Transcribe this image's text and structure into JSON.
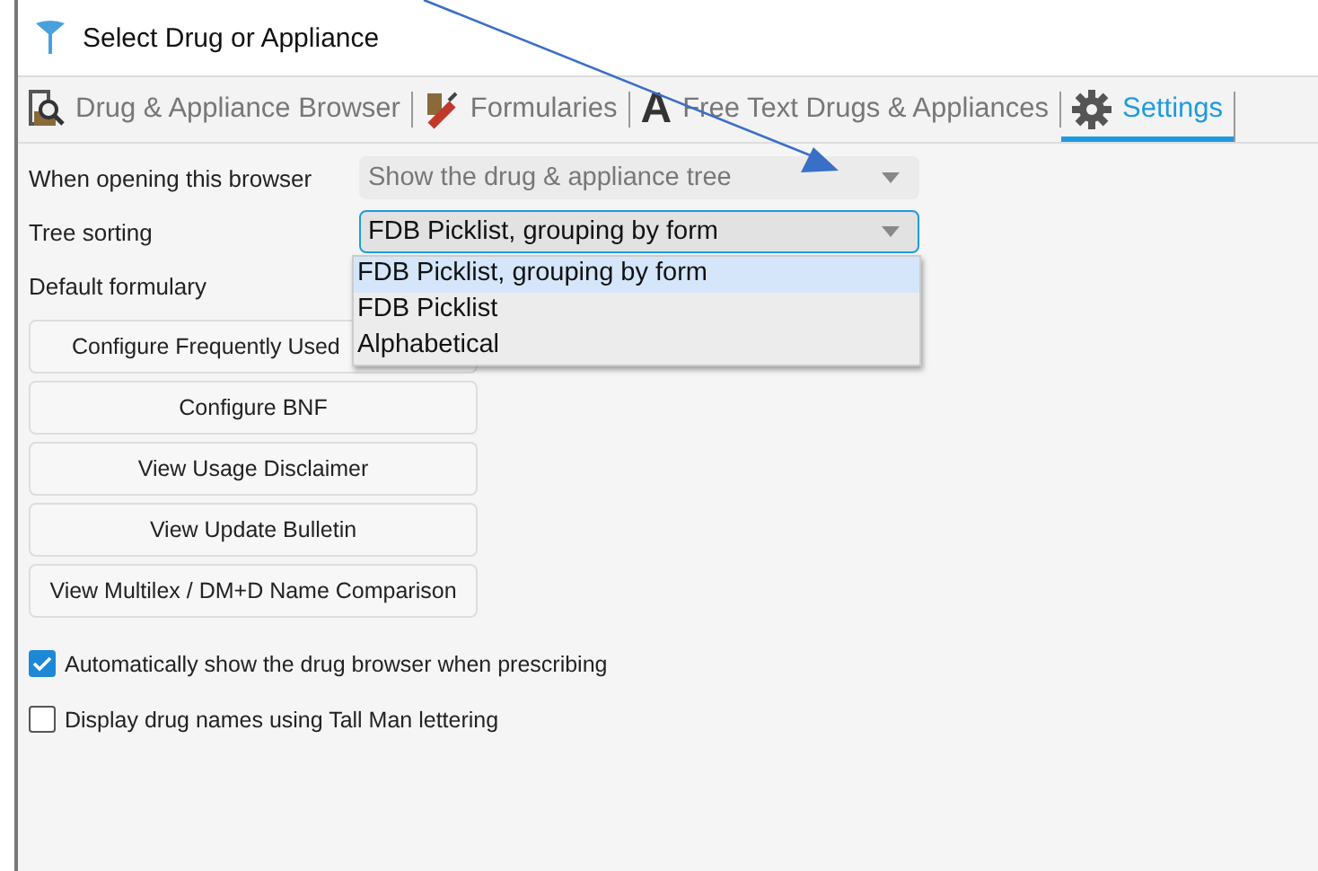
{
  "window": {
    "title": "Select Drug or Appliance"
  },
  "tabs": [
    {
      "label": "Drug & Appliance Browser",
      "kind": "browser",
      "selected": false
    },
    {
      "label": "Formularies",
      "kind": "formulary",
      "selected": false
    },
    {
      "label": "Free Text Drugs & Appliances",
      "kind": "letter",
      "glyph": "A",
      "selected": false
    },
    {
      "label": "Settings",
      "kind": "gear",
      "selected": true
    }
  ],
  "settings": [
    {
      "label": "When opening this browser",
      "value": "Show the drug & appliance tree",
      "disabled": true,
      "focused": false
    },
    {
      "label": "Tree sorting",
      "value": "FDB Picklist, grouping by form",
      "disabled": false,
      "focused": true
    },
    {
      "label": "Default formulary"
    }
  ],
  "dropdown_options": [
    {
      "label": "FDB Picklist, grouping by form",
      "selected": true
    },
    {
      "label": "FDB Picklist",
      "selected": false
    },
    {
      "label": "Alphabetical",
      "selected": false
    }
  ],
  "buttons": [
    "Configure Frequently Used",
    "Configure BNF",
    "View Usage Disclaimer",
    "View Update Bulletin",
    "View Multilex / DM+D Name Comparison"
  ],
  "checkboxes": [
    {
      "label": "Automatically show the drug browser when prescribing",
      "checked": true
    },
    {
      "label": "Display drug names using Tall Man lettering",
      "checked": false
    }
  ]
}
